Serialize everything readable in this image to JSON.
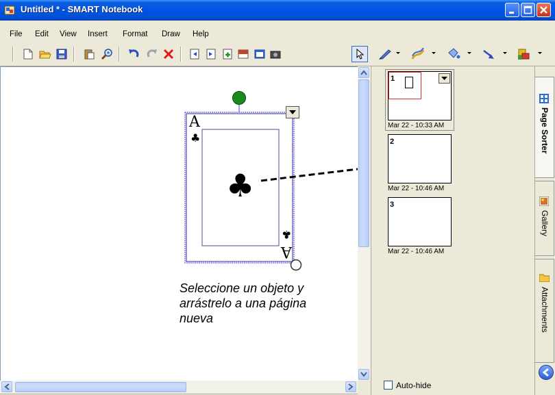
{
  "window": {
    "title": "Untitled * - SMART Notebook",
    "controls": [
      "minimize-icon",
      "maximize-icon",
      "close-icon"
    ]
  },
  "menu": {
    "items": [
      "File",
      "Edit",
      "View",
      "Insert",
      "Format",
      "Draw",
      "Help"
    ]
  },
  "toolbar": {
    "icons": [
      "new-page-icon",
      "open-folder-icon",
      "save-icon",
      "paste-icon",
      "zoom-icon",
      "undo-icon",
      "redo-icon",
      "delete-icon",
      "previous-page-icon",
      "next-page-icon",
      "add-page-icon",
      "screen-shade-icon",
      "full-screen-icon",
      "capture-icon",
      "select-arrow-icon",
      "pen-icon",
      "creative-pen-icon",
      "fill-icon",
      "line-icon",
      "shapes-icon"
    ]
  },
  "canvas": {
    "card": {
      "rank_top": "A",
      "rank_bottom": "A",
      "suit_symbol": "♣"
    },
    "caption": "Seleccione un objeto y arrástrelo a una página nueva"
  },
  "page_sorter": {
    "pages": [
      {
        "number": "1",
        "date": "Mar 22 - 10:33 AM",
        "selected": true
      },
      {
        "number": "2",
        "date": "Mar 22 - 10:46 AM",
        "selected": false
      },
      {
        "number": "3",
        "date": "Mar 22 - 10:46 AM",
        "selected": false
      }
    ],
    "auto_hide_label": "Auto-hide",
    "auto_hide_checked": false
  },
  "side_tabs": {
    "page_sorter": "Page Sorter",
    "gallery": "Gallery",
    "attachments": "Attachments"
  },
  "colors": {
    "titlebar": "#0054e3",
    "selection": "#3a3aff",
    "rotate_handle": "#1a8a1a",
    "thumb_selection": "#e03030"
  }
}
